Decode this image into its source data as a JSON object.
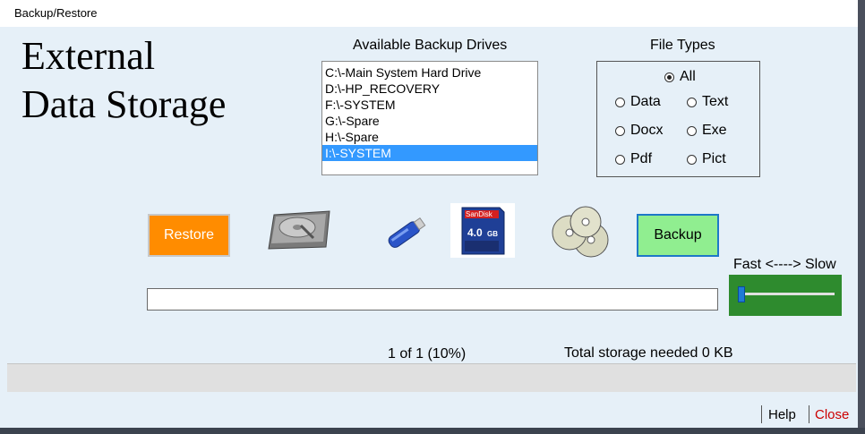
{
  "window": {
    "title": "Backup/Restore"
  },
  "heading": {
    "line1": "External",
    "line2": "Data Storage"
  },
  "drives": {
    "label": "Available Backup Drives",
    "items": [
      {
        "label": "C:\\-Main System Hard Drive",
        "selected": false
      },
      {
        "label": "D:\\-HP_RECOVERY",
        "selected": false
      },
      {
        "label": "F:\\-SYSTEM",
        "selected": false
      },
      {
        "label": "G:\\-Spare",
        "selected": false
      },
      {
        "label": "H:\\-Spare",
        "selected": false
      },
      {
        "label": "I:\\-SYSTEM",
        "selected": true
      }
    ]
  },
  "file_types": {
    "label": "File Types",
    "selected": "All",
    "options": [
      "All",
      "Data",
      "Text",
      "Docx",
      "Exe",
      "Pdf",
      "Pict"
    ]
  },
  "buttons": {
    "restore": "Restore",
    "backup": "Backup",
    "help": "Help",
    "close": "Close"
  },
  "media_icons": [
    "hard-drive-icon",
    "usb-drive-icon",
    "sd-card-icon",
    "cd-discs-icon"
  ],
  "sd_card": {
    "brand": "SanDisk",
    "capacity": "4.0",
    "unit": "GB"
  },
  "speed": {
    "label": "Fast <----> Slow",
    "value": 0
  },
  "progress": {
    "value": 0,
    "text": "1 of 1 (10%)"
  },
  "storage": {
    "text": "Total storage needed 0 KB"
  },
  "colors": {
    "accent_orange": "#ff8c00",
    "accent_green": "#90ee90",
    "selection": "#3399ff",
    "close_red": "#cc0000",
    "slider_green": "#2e8b2e"
  }
}
